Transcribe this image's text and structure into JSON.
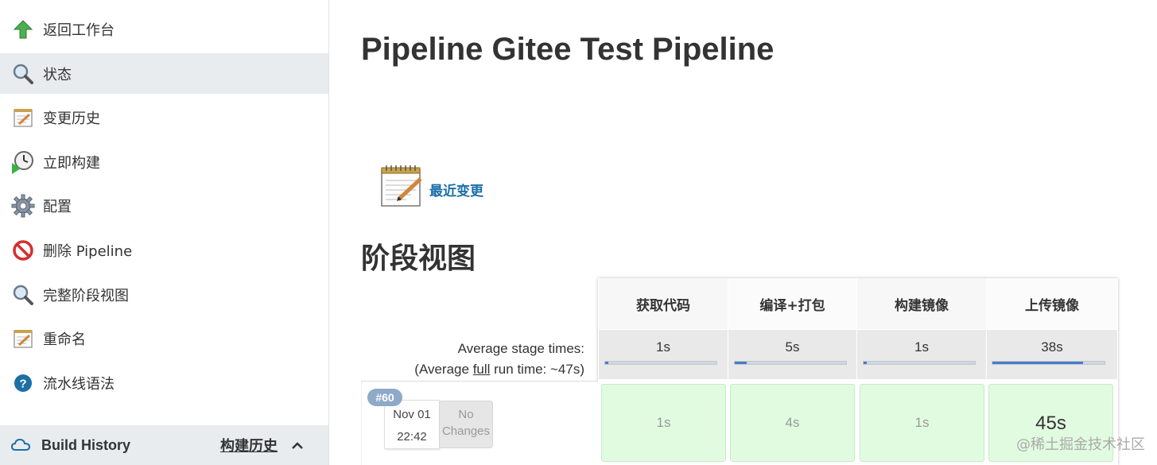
{
  "sidebar": {
    "items": [
      {
        "label": "返回工作台",
        "icon": "arrow-up-icon"
      },
      {
        "label": "状态",
        "icon": "magnifier-icon"
      },
      {
        "label": "变更历史",
        "icon": "notepad-icon"
      },
      {
        "label": "立即构建",
        "icon": "clock-play-icon"
      },
      {
        "label": "配置",
        "icon": "gear-icon"
      },
      {
        "label": "删除 Pipeline",
        "icon": "no-entry-icon"
      },
      {
        "label": "完整阶段视图",
        "icon": "magnifier-icon"
      },
      {
        "label": "重命名",
        "icon": "notepad-icon"
      },
      {
        "label": "流水线语法",
        "icon": "help-icon"
      }
    ],
    "build_history": {
      "label": "Build History",
      "link": "构建历史",
      "icon": "cloud-icon"
    }
  },
  "main": {
    "title": "Pipeline Gitee Test Pipeline",
    "recent_changes": "最近变更",
    "stage_view_heading": "阶段视图"
  },
  "stage_view": {
    "stages": [
      "获取代码",
      "编译+打包",
      "构建镜像",
      "上传镜像"
    ],
    "avg_label_line1": "Average stage times:",
    "avg_label_prefix": "(Average ",
    "avg_label_full": "full",
    "avg_label_suffix": " run time: ~47s)",
    "avg_times": [
      "1s",
      "5s",
      "1s",
      "38s"
    ],
    "avg_fraction": [
      0.03,
      0.11,
      0.03,
      0.81
    ],
    "run": {
      "badge": "#60",
      "date": "Nov 01",
      "time": "22:42",
      "changes": "No Changes",
      "stage_times": [
        "1s",
        "4s",
        "1s",
        "45s"
      ]
    }
  },
  "colors": {
    "success_bg": "#e1fbe0",
    "link": "#1b6fa8",
    "bar_fill": "#4a7cc9",
    "badge": "#8fa9c9"
  },
  "watermark": "@稀土掘金技术社区"
}
